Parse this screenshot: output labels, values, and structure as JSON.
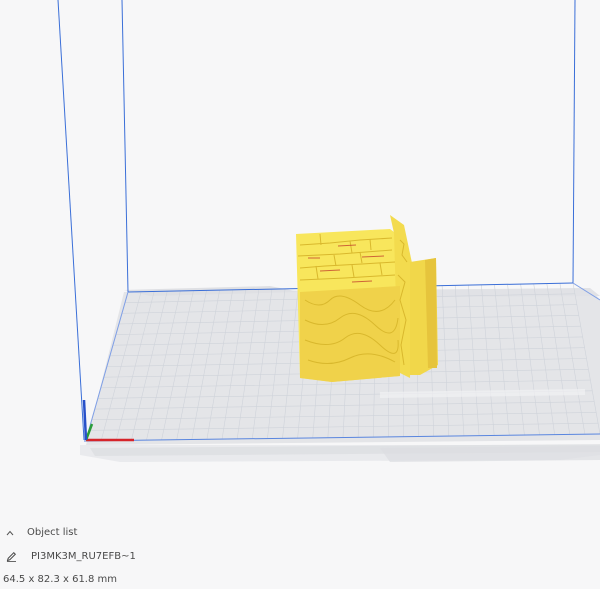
{
  "viewport": {
    "background_color": "#f7f7f8",
    "build_plate_color": "#e6e7ea",
    "grid_line_color": "#cfd3da",
    "volume_edge_color": "#3b6fd8",
    "model_color": "#f8e65c",
    "model_shadow_color": "#d9b82d",
    "model_detail_color": "#c0392b",
    "axis_x_color": "#d6242a",
    "axis_y_color": "#2a9d3a",
    "axis_z_color": "#2750c9"
  },
  "object_panel": {
    "header_label": "Object list",
    "header_icon": "chevron-up-icon",
    "object_name": "PI3MK3M_RU7EFB~1",
    "object_icon": "pencil-icon",
    "dimensions": "64.5 x 82.3 x 61.8 mm"
  }
}
